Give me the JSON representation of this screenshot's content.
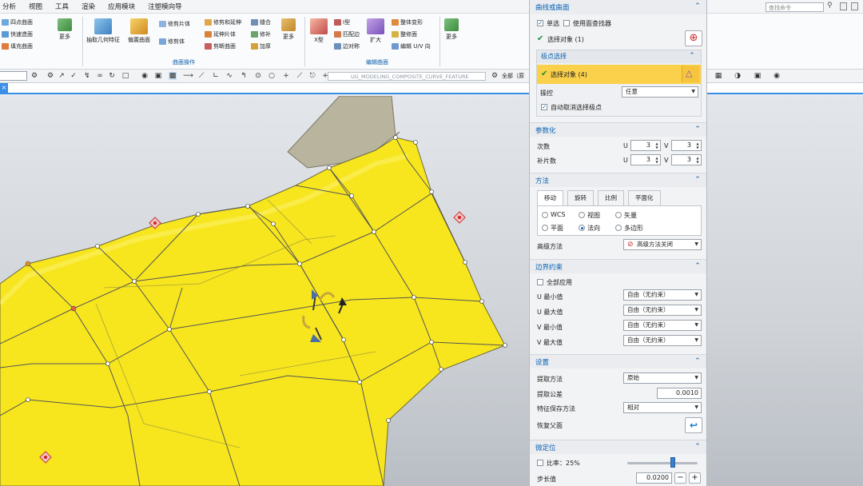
{
  "menu": [
    "分析",
    "视图",
    "工具",
    "渲染",
    "应用模块",
    "注塑模向导"
  ],
  "command_search": {
    "placeholder": "查找命令"
  },
  "ribbon": {
    "left_items": [
      "四点曲面",
      "快速造面",
      "填充曲面"
    ],
    "more_label": "更多",
    "big_buttons": [
      "抽取几何特征",
      "偏置曲面",
      "修剪体"
    ],
    "surface_ops": [
      "修剪片体",
      "修剪和延伸",
      "延伸片体",
      "剪断曲面",
      "缝合",
      "修补",
      "加厚"
    ],
    "group_label_1": "曲面操作",
    "x_label": "X型",
    "edit_items": [
      "I型",
      "匹配边",
      "边对称",
      "扩大",
      "整体变形",
      "整修面",
      "编辑 U/V 向"
    ],
    "group_label_2": "编辑曲面"
  },
  "selbar": {
    "part_name": "UG_MODELING_COMPOSITE_CURVE_FEATURE",
    "all": "全部（原"
  },
  "dialog": {
    "sec1_title": "曲线或曲面",
    "single_select": "单选",
    "use_face_finder": "使用面查找器",
    "select_object_1": "选择对象 (1)",
    "sec2_title": "极点选择",
    "select_object_4": "选择对象 (4)",
    "manip_label": "操控",
    "manip_value": "任意",
    "auto_cancel": "自动取消选择极点",
    "param_title": "参数化",
    "degree_label": "次数",
    "patches_label": "补片数",
    "u": "U",
    "v": "V",
    "degree_u": "3",
    "degree_v": "3",
    "patch_u": "3",
    "patch_v": "3",
    "method_title": "方法",
    "tabs": [
      "移动",
      "旋转",
      "比例",
      "平面化"
    ],
    "radios": [
      "WCS",
      "视图",
      "矢量",
      "平面",
      "法向",
      "多边形"
    ],
    "adv_label": "高级方法",
    "adv_value": "高级方法关闭",
    "boundary_title": "边界约束",
    "apply_all": "全部应用",
    "bounds": [
      {
        "label": "U 最小值",
        "value": "自由（无约束）"
      },
      {
        "label": "U 最大值",
        "value": "自由（无约束）"
      },
      {
        "label": "V 最小值",
        "value": "自由（无约束）"
      },
      {
        "label": "V 最大值",
        "value": "自由（无约束）"
      }
    ],
    "settings_title": "设置",
    "extract_label": "提取方法",
    "extract_value": "原始",
    "tol_label": "提取公差",
    "tol_value": "0.0010",
    "feature_label": "特征保存方法",
    "feature_value": "相对",
    "restore_label": "恢复父面",
    "fine_title": "微定位",
    "ratio_label": "比率：25%",
    "ratio_value": 0.25,
    "step_label": "步长值",
    "step_value": "0.0200"
  },
  "colors": {
    "accent": "#0b62b5",
    "surface": "#f7e61e",
    "highlight": "#fbd04a"
  }
}
